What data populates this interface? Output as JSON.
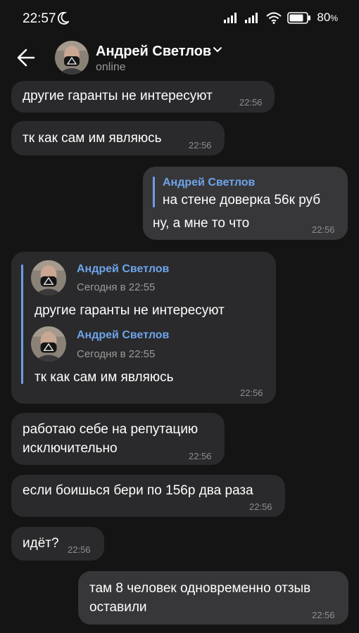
{
  "status_bar": {
    "time": "22:57",
    "battery": "80"
  },
  "header": {
    "contact_name": "Андрей Светлов",
    "status": "online"
  },
  "messages": [
    {
      "text": "другие гаранты не интересуют",
      "time": "22:56"
    },
    {
      "text": "тк как сам им являюсь",
      "time": "22:56"
    },
    {
      "quote_name": "Андрей Светлов",
      "quote_text": "на стене доверка 56к руб",
      "text": "ну, а мне то что",
      "time": "22:56"
    },
    {
      "forwarded": [
        {
          "author": "Андрей Светлов",
          "date": "Сегодня в 22:55",
          "text": "другие гаранты не интересуют"
        },
        {
          "author": "Андрей Светлов",
          "date": "Сегодня в 22:55",
          "text": "тк как сам им являюсь"
        }
      ],
      "time": "22:56"
    },
    {
      "line1": "работаю себе на репутацию",
      "line2": "исключительно",
      "time": "22:56"
    },
    {
      "text": "если боишься бери по 156р два раза",
      "time": "22:56"
    },
    {
      "text": "идёт?",
      "time": "22:56"
    },
    {
      "line1": "там 8 человек одновременно отзыв",
      "line2": "оставили",
      "time": "22:56"
    }
  ]
}
